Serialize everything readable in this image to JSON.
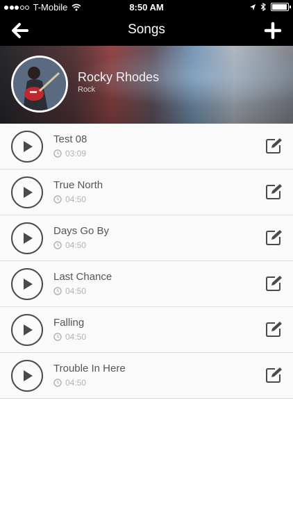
{
  "status_bar": {
    "carrier": "T-Mobile",
    "time": "8:50 AM",
    "signal_bars_filled": 3,
    "signal_bars_total": 5,
    "battery_level": 0.95
  },
  "nav": {
    "title": "Songs",
    "back_icon": "arrow-left-icon",
    "add_icon": "plus-icon"
  },
  "artist": {
    "name": "Rocky Rhodes",
    "genre": "Rock"
  },
  "songs": [
    {
      "title": "Test 08",
      "duration": "03:09"
    },
    {
      "title": "True North",
      "duration": "04:50"
    },
    {
      "title": "Days Go By",
      "duration": "04:50"
    },
    {
      "title": "Last Chance",
      "duration": "04:50"
    },
    {
      "title": "Falling",
      "duration": "04:50"
    },
    {
      "title": "Trouble In Here",
      "duration": "04:50"
    }
  ],
  "colors": {
    "bar_background": "#000000",
    "row_background": "#fafafa",
    "divider": "#dcdcdc",
    "icon": "#4a4a4a"
  }
}
